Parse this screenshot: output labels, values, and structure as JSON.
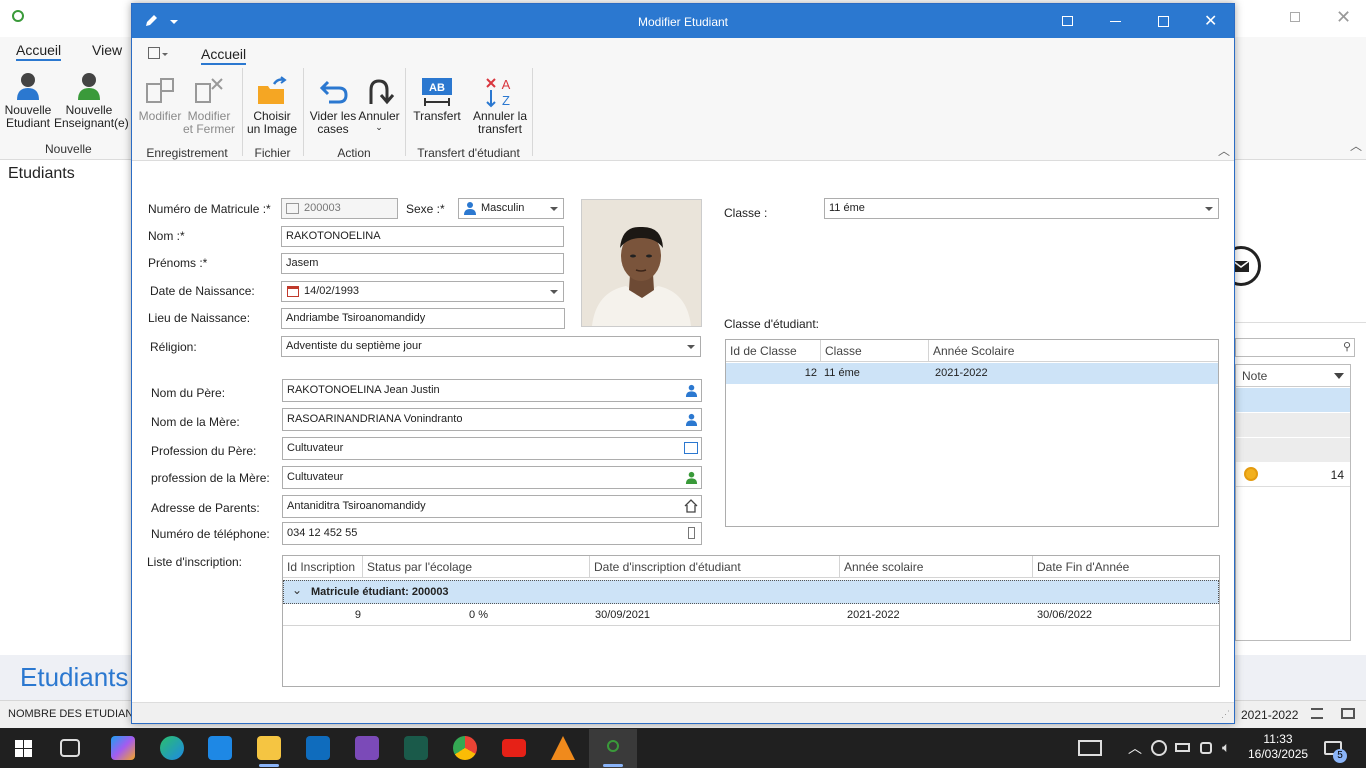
{
  "background_app": {
    "tabs": [
      "Accueil",
      "View"
    ],
    "buttons": [
      {
        "label": "Nouvelle Etudiant",
        "line1": "Nouvelle",
        "line2": "Etudiant"
      },
      {
        "label": "Nouvelle Enseignant(e)",
        "line1": "Nouvelle",
        "line2": "Enseignant(e)"
      }
    ],
    "group_label": "Nouvelle",
    "left_title": "Etudiants",
    "banner_title": "Etudiants",
    "status_left": "NOMBRE DES ETUDIANTS",
    "status_right": "2021-2022",
    "right_grid_header": "Note",
    "right_grid_value": "14"
  },
  "dialog": {
    "title": "Modifier Etudiant",
    "ribbon_tab": "Accueil",
    "ribbon_buttons": [
      {
        "line1": "Modifier",
        "line2": ""
      },
      {
        "line1": "Modifier",
        "line2": "et Fermer"
      },
      {
        "line1": "Choisir",
        "line2": "un Image"
      },
      {
        "line1": "Vider les",
        "line2": "cases"
      },
      {
        "line1": "Annuler",
        "line2": ""
      },
      {
        "line1": "Transfert",
        "line2": ""
      },
      {
        "line1": "Annuler la",
        "line2": "transfert"
      }
    ],
    "ribbon_groups": [
      "Enregistrement",
      "Fichier",
      "Action",
      "Transfert d'étudiant"
    ],
    "form": {
      "matricule_label": "Numéro de Matricule :*",
      "matricule_value": "200003",
      "sexe_label": "Sexe :*",
      "sexe_value": "Masculin",
      "nom_label": "Nom :*",
      "nom_value": "RAKOTONOELINA",
      "prenoms_label": "Prénoms :*",
      "prenoms_value": "Jasem",
      "naissance_label": "Date de Naissance:",
      "naissance_value": "14/02/1993",
      "lieu_label": "Lieu de Naissance:",
      "lieu_value": "Andriambe Tsiroanomandidy",
      "religion_label": "Réligion:",
      "religion_value": "Adventiste du septième jour",
      "pere_label": "Nom du Père:",
      "pere_value": "RAKOTONOELINA Jean Justin",
      "mere_label": "Nom de la Mère:",
      "mere_value": "RASOARINANDRIANA Vonindranto",
      "prof_pere_label": "Profession du Père:",
      "prof_pere_value": "Cultuvateur",
      "prof_mere_label": "profession de la Mère:",
      "prof_mere_value": "Cultuvateur",
      "adresse_label": "Adresse de Parents:",
      "adresse_value": "Antaniditra Tsiroanomandidy",
      "tel_label": "Numéro de téléphone:",
      "tel_value": "034 12 452 55",
      "classe_label": "Classe :",
      "classe_value": "11 éme",
      "classe_etudiant_label": "Classe d'étudiant:",
      "inscription_label": "Liste d'inscription:"
    },
    "class_grid": {
      "columns": [
        "Id de Classe",
        "Classe",
        "Année Scolaire"
      ],
      "rows": [
        {
          "id": "12",
          "classe": "11 éme",
          "annee": "2021-2022"
        }
      ]
    },
    "inscription_grid": {
      "columns": [
        "Id Inscription",
        "Status par l'écolage",
        "Date d'inscription d'étudiant",
        "Année scolaire",
        "Date Fin d'Année"
      ],
      "group_row": "Matricule étudiant: 200003",
      "rows": [
        {
          "id": "9",
          "status": "0 %",
          "date_insc": "30/09/2021",
          "annee": "2021-2022",
          "date_fin": "30/06/2022"
        }
      ]
    }
  },
  "taskbar": {
    "time": "11:33",
    "date": "16/03/2025",
    "notification_count": "5"
  }
}
